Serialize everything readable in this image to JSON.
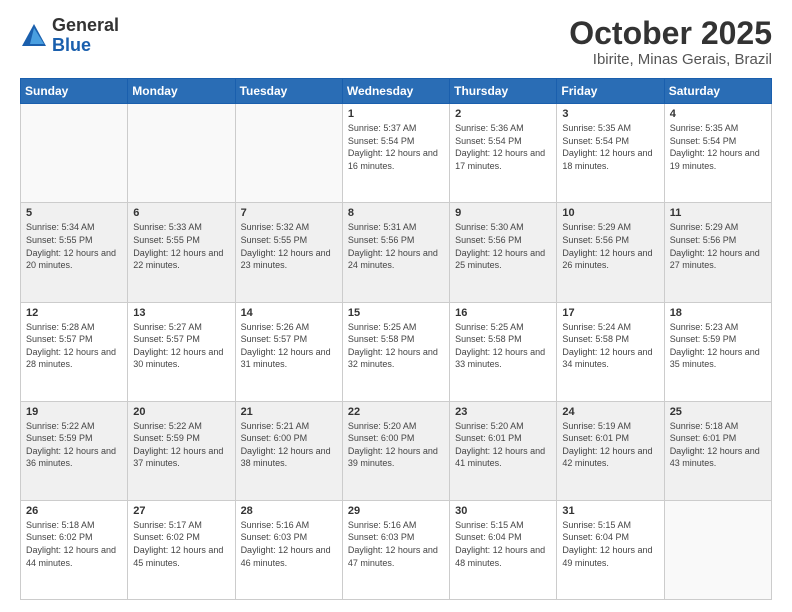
{
  "logo": {
    "general": "General",
    "blue": "Blue"
  },
  "title": "October 2025",
  "location": "Ibirite, Minas Gerais, Brazil",
  "weekdays": [
    "Sunday",
    "Monday",
    "Tuesday",
    "Wednesday",
    "Thursday",
    "Friday",
    "Saturday"
  ],
  "weeks": [
    [
      {
        "day": "",
        "info": ""
      },
      {
        "day": "",
        "info": ""
      },
      {
        "day": "",
        "info": ""
      },
      {
        "day": "1",
        "info": "Sunrise: 5:37 AM\nSunset: 5:54 PM\nDaylight: 12 hours\nand 16 minutes."
      },
      {
        "day": "2",
        "info": "Sunrise: 5:36 AM\nSunset: 5:54 PM\nDaylight: 12 hours\nand 17 minutes."
      },
      {
        "day": "3",
        "info": "Sunrise: 5:35 AM\nSunset: 5:54 PM\nDaylight: 12 hours\nand 18 minutes."
      },
      {
        "day": "4",
        "info": "Sunrise: 5:35 AM\nSunset: 5:54 PM\nDaylight: 12 hours\nand 19 minutes."
      }
    ],
    [
      {
        "day": "5",
        "info": "Sunrise: 5:34 AM\nSunset: 5:55 PM\nDaylight: 12 hours\nand 20 minutes."
      },
      {
        "day": "6",
        "info": "Sunrise: 5:33 AM\nSunset: 5:55 PM\nDaylight: 12 hours\nand 22 minutes."
      },
      {
        "day": "7",
        "info": "Sunrise: 5:32 AM\nSunset: 5:55 PM\nDaylight: 12 hours\nand 23 minutes."
      },
      {
        "day": "8",
        "info": "Sunrise: 5:31 AM\nSunset: 5:56 PM\nDaylight: 12 hours\nand 24 minutes."
      },
      {
        "day": "9",
        "info": "Sunrise: 5:30 AM\nSunset: 5:56 PM\nDaylight: 12 hours\nand 25 minutes."
      },
      {
        "day": "10",
        "info": "Sunrise: 5:29 AM\nSunset: 5:56 PM\nDaylight: 12 hours\nand 26 minutes."
      },
      {
        "day": "11",
        "info": "Sunrise: 5:29 AM\nSunset: 5:56 PM\nDaylight: 12 hours\nand 27 minutes."
      }
    ],
    [
      {
        "day": "12",
        "info": "Sunrise: 5:28 AM\nSunset: 5:57 PM\nDaylight: 12 hours\nand 28 minutes."
      },
      {
        "day": "13",
        "info": "Sunrise: 5:27 AM\nSunset: 5:57 PM\nDaylight: 12 hours\nand 30 minutes."
      },
      {
        "day": "14",
        "info": "Sunrise: 5:26 AM\nSunset: 5:57 PM\nDaylight: 12 hours\nand 31 minutes."
      },
      {
        "day": "15",
        "info": "Sunrise: 5:25 AM\nSunset: 5:58 PM\nDaylight: 12 hours\nand 32 minutes."
      },
      {
        "day": "16",
        "info": "Sunrise: 5:25 AM\nSunset: 5:58 PM\nDaylight: 12 hours\nand 33 minutes."
      },
      {
        "day": "17",
        "info": "Sunrise: 5:24 AM\nSunset: 5:58 PM\nDaylight: 12 hours\nand 34 minutes."
      },
      {
        "day": "18",
        "info": "Sunrise: 5:23 AM\nSunset: 5:59 PM\nDaylight: 12 hours\nand 35 minutes."
      }
    ],
    [
      {
        "day": "19",
        "info": "Sunrise: 5:22 AM\nSunset: 5:59 PM\nDaylight: 12 hours\nand 36 minutes."
      },
      {
        "day": "20",
        "info": "Sunrise: 5:22 AM\nSunset: 5:59 PM\nDaylight: 12 hours\nand 37 minutes."
      },
      {
        "day": "21",
        "info": "Sunrise: 5:21 AM\nSunset: 6:00 PM\nDaylight: 12 hours\nand 38 minutes."
      },
      {
        "day": "22",
        "info": "Sunrise: 5:20 AM\nSunset: 6:00 PM\nDaylight: 12 hours\nand 39 minutes."
      },
      {
        "day": "23",
        "info": "Sunrise: 5:20 AM\nSunset: 6:01 PM\nDaylight: 12 hours\nand 41 minutes."
      },
      {
        "day": "24",
        "info": "Sunrise: 5:19 AM\nSunset: 6:01 PM\nDaylight: 12 hours\nand 42 minutes."
      },
      {
        "day": "25",
        "info": "Sunrise: 5:18 AM\nSunset: 6:01 PM\nDaylight: 12 hours\nand 43 minutes."
      }
    ],
    [
      {
        "day": "26",
        "info": "Sunrise: 5:18 AM\nSunset: 6:02 PM\nDaylight: 12 hours\nand 44 minutes."
      },
      {
        "day": "27",
        "info": "Sunrise: 5:17 AM\nSunset: 6:02 PM\nDaylight: 12 hours\nand 45 minutes."
      },
      {
        "day": "28",
        "info": "Sunrise: 5:16 AM\nSunset: 6:03 PM\nDaylight: 12 hours\nand 46 minutes."
      },
      {
        "day": "29",
        "info": "Sunrise: 5:16 AM\nSunset: 6:03 PM\nDaylight: 12 hours\nand 47 minutes."
      },
      {
        "day": "30",
        "info": "Sunrise: 5:15 AM\nSunset: 6:04 PM\nDaylight: 12 hours\nand 48 minutes."
      },
      {
        "day": "31",
        "info": "Sunrise: 5:15 AM\nSunset: 6:04 PM\nDaylight: 12 hours\nand 49 minutes."
      },
      {
        "day": "",
        "info": ""
      }
    ]
  ]
}
